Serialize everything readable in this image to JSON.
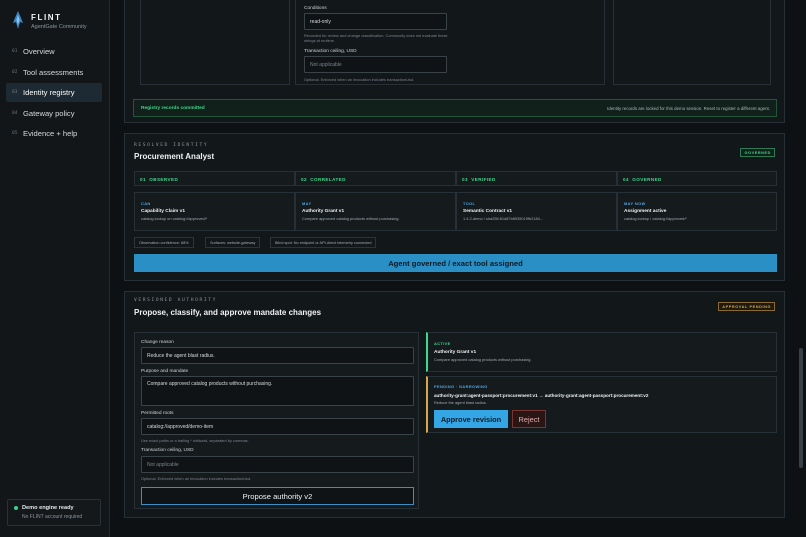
{
  "brand": {
    "name": "FLINT",
    "subtitle": "AgentGate Community"
  },
  "nav": [
    {
      "num": "01",
      "label": "Overview"
    },
    {
      "num": "02",
      "label": "Tool assessments"
    },
    {
      "num": "03",
      "label": "Identity registry"
    },
    {
      "num": "04",
      "label": "Gateway policy"
    },
    {
      "num": "05",
      "label": "Evidence + help"
    }
  ],
  "engine": {
    "title": "Demo engine ready",
    "subtitle": "No FLINT account required"
  },
  "registry_form": {
    "conditions_label": "Conditions",
    "conditions_value": "read-only",
    "conditions_help": "Recorded for review and change classification. Community does not evaluate these strings at runtime.",
    "ceiling_label": "Transaction ceiling, USD",
    "ceiling_placeholder": "Not applicable",
    "ceiling_help": "Optional. Enforced when an invocation includes transactionUsd.",
    "committed_label": "Registry records committed",
    "committed_note": "Identity records are locked for this demo session. Reset to register a different agent."
  },
  "resolved": {
    "kicker": "RESOLVED IDENTITY",
    "title": "Procurement Analyst",
    "badge": "GOVERNED",
    "stages": [
      {
        "num": "01",
        "label": "OBSERVED"
      },
      {
        "num": "02",
        "label": "CORRELATED"
      },
      {
        "num": "03",
        "label": "VERIFIED"
      },
      {
        "num": "04",
        "label": "GOVERNED"
      }
    ],
    "cards": [
      {
        "type": "CAN",
        "name": "Capability Claim v1",
        "desc": "catalog.lookup on catalog://approved/*"
      },
      {
        "type": "MAY",
        "name": "Authority Grant v1",
        "desc": "Compare approved catalog products without purchasing."
      },
      {
        "type": "TOOL",
        "name": "Semantic Contract v1",
        "desc": "1.4.2-demo / sha256:61d87b8935019fb2184..."
      },
      {
        "type": "MAY NOW",
        "name": "Assignment active",
        "desc": "catalog.lookup / catalog://approved/*"
      }
    ],
    "chips": [
      "Observation confidence: 88%",
      "Surfaces: website-gateway",
      "Blind spot: No endpoint or API-direct telemetry connected"
    ],
    "status_bar": "Agent governed / exact tool assigned"
  },
  "versioned": {
    "kicker": "VERSIONED AUTHORITY",
    "title": "Propose, classify, and approve mandate changes",
    "badge": "APPROVAL PENDING",
    "form": {
      "reason_label": "Change reason",
      "reason_value": "Reduce the agent blast radius.",
      "purpose_label": "Purpose and mandate",
      "purpose_value": "Compare approved catalog products without purchasing.",
      "roots_label": "Permitted roots",
      "roots_value": "catalog://approved/demo-item",
      "roots_help": "Use exact paths or a trailing * wildcard, separated by commas.",
      "ceiling_label": "Transaction ceiling, USD",
      "ceiling_placeholder": "Not applicable",
      "ceiling_help": "Optional. Enforced when an invocation includes transactionUsd.",
      "propose_button": "Propose authority v2"
    },
    "active": {
      "tag": "ACTIVE",
      "name": "Authority Grant v1",
      "desc": "Compare approved catalog products without purchasing."
    },
    "pending": {
      "tag": "PENDING · NARROWING",
      "change": "authority-grant:agent-passport:procurement:v1 → authority-grant:agent-passport:procurement:v2",
      "desc": "Reduce the agent blast radius.",
      "approve_button": "Approve revision",
      "reject_button": "Reject"
    }
  },
  "colors": {
    "green": "#3fd88e",
    "blue": "#4fa8e6",
    "amber": "#d8a64a",
    "bar": "#2a8fc4"
  }
}
